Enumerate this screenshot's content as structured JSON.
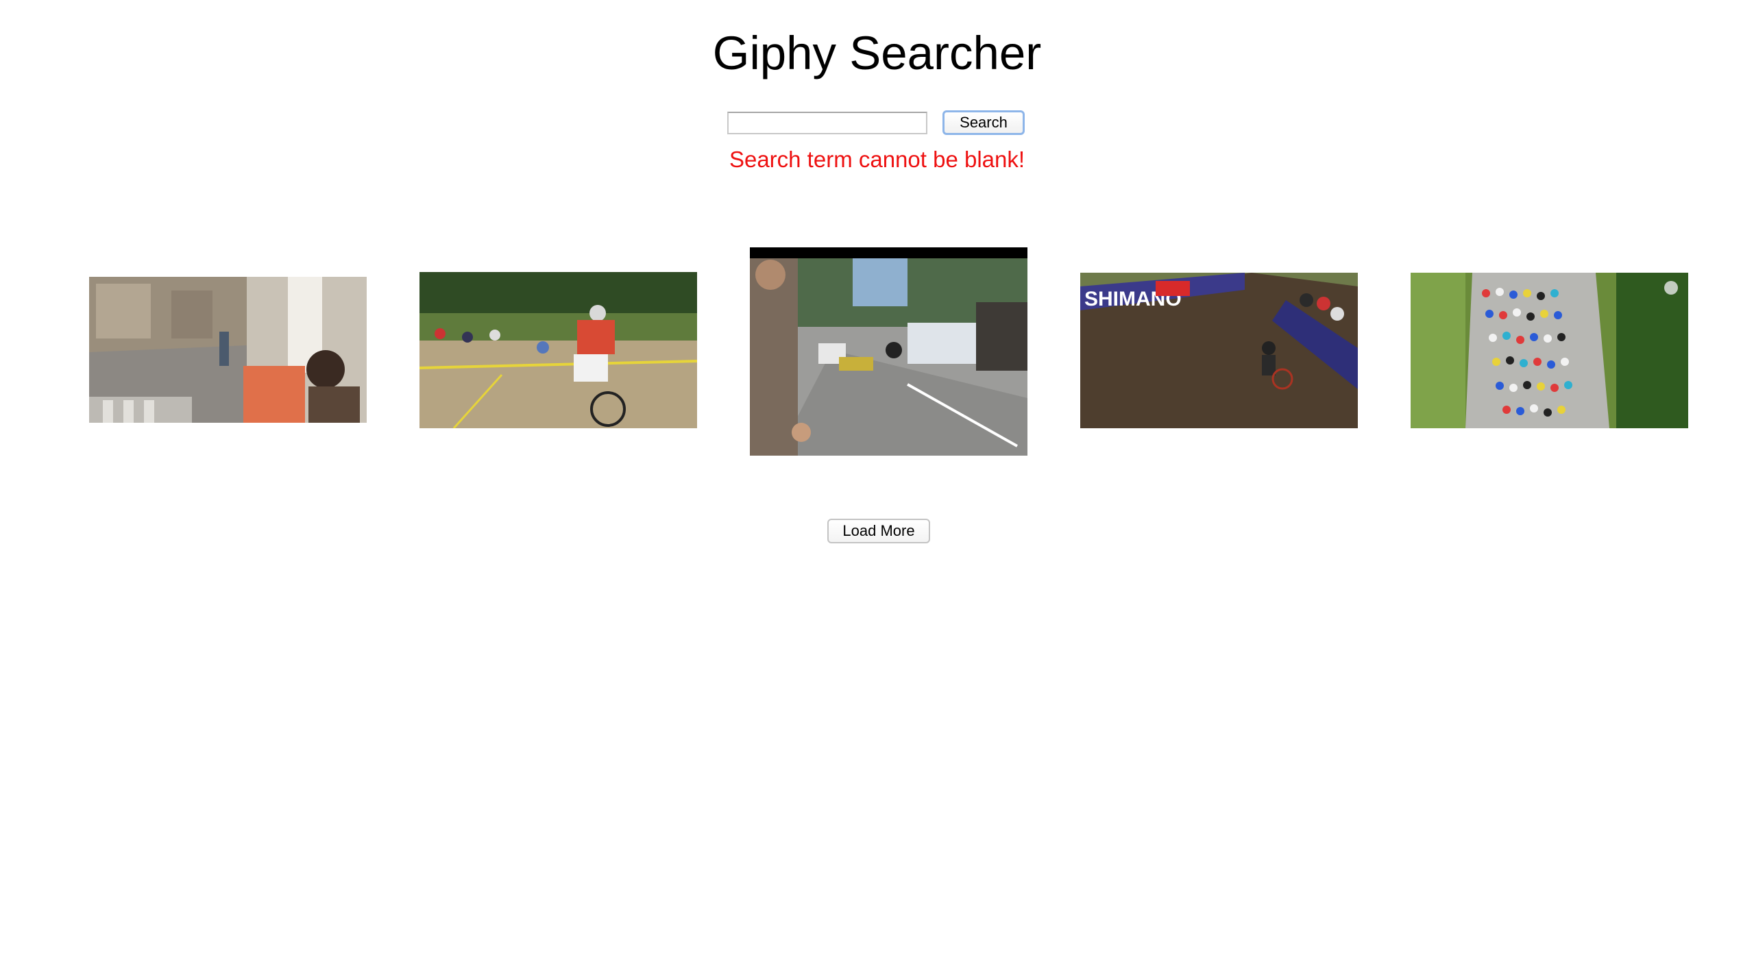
{
  "app": {
    "title": "Giphy Searcher"
  },
  "search": {
    "value": "",
    "placeholder": "",
    "button_label": "Search",
    "error_message": "Search term cannot be blank!"
  },
  "results": {
    "gifs": [
      {
        "subject": "cyclist crash on street with painter"
      },
      {
        "subject": "cyclocross riders crashing in sand"
      },
      {
        "subject": "road race pileup behind spectator barrier"
      },
      {
        "subject": "cyclocross rider slipping on muddy slope"
      },
      {
        "subject": "aerial view of peloton on road"
      }
    ],
    "load_more_label": "Load More"
  },
  "colors": {
    "error": "#ee1111",
    "button_focus_border": "#8db5e9"
  }
}
